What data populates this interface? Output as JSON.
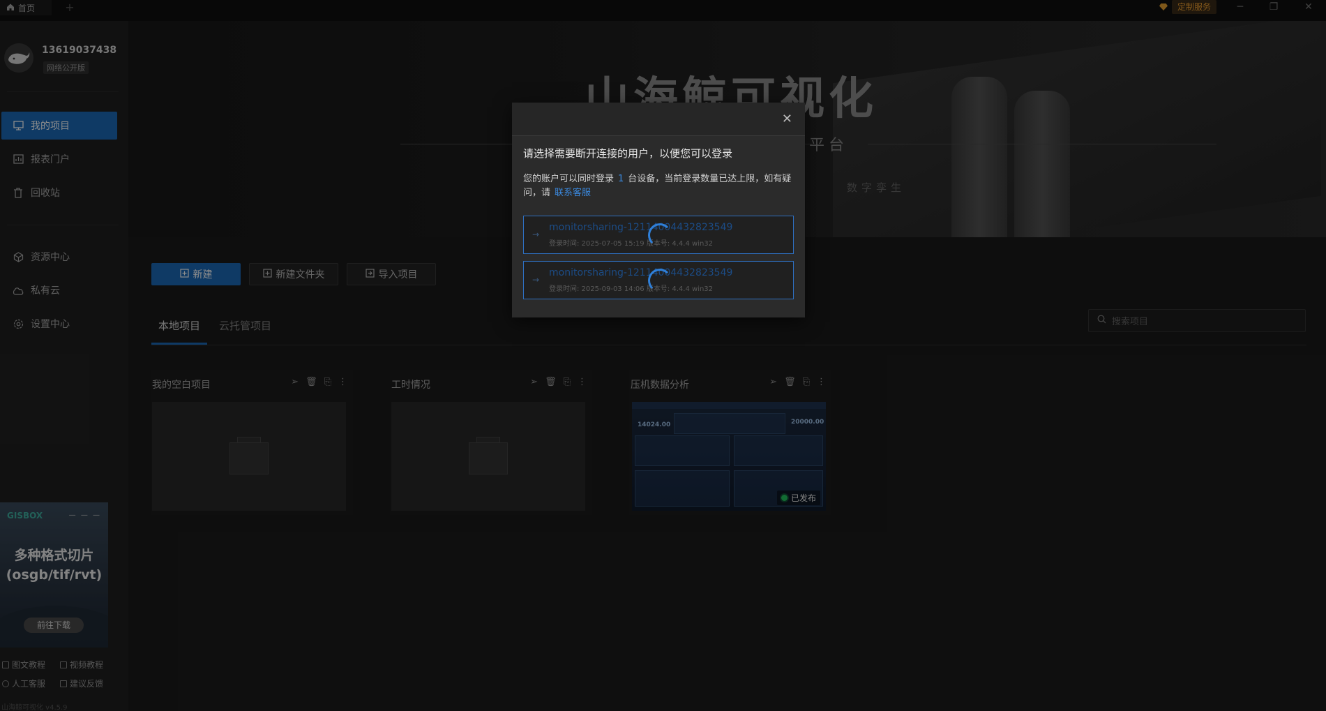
{
  "titlebar": {
    "home_tab": "首页",
    "add_tab": "+",
    "custom_service": "定制服务",
    "minimize": "─",
    "maximize": "❐",
    "close": "✕"
  },
  "user": {
    "name": "13619037438",
    "badge": "网络公开版"
  },
  "nav": [
    {
      "label": "我的项目",
      "icon": "monitor-icon",
      "active": true
    },
    {
      "label": "报表门户",
      "icon": "chart-icon",
      "active": false
    },
    {
      "label": "回收站",
      "icon": "trash-icon",
      "active": false
    },
    {
      "label": "资源中心",
      "icon": "cube-icon",
      "active": false
    },
    {
      "label": "私有云",
      "icon": "cloud-icon",
      "active": false
    },
    {
      "label": "设置中心",
      "icon": "gear-icon",
      "active": false
    }
  ],
  "promo": {
    "brand": "GISBOX",
    "title_line1": "多种格式切片",
    "title_line2": "(osgb/tif/rvt)",
    "button": "前往下载"
  },
  "help_links": {
    "graphic_tutorial": "图文教程",
    "video_tutorial": "视频教程",
    "support": "人工客服",
    "feedback": "建议反馈"
  },
  "version": "山海鲸可视化 v4.5.9",
  "banner": {
    "title": "山海鲸可视化",
    "subtitle": "平台",
    "tagline": "数字孪生"
  },
  "toolbar": {
    "new": "新建",
    "new_folder": "新建文件夹",
    "import": "导入项目"
  },
  "tabs": {
    "local": "本地项目",
    "cloud": "云托管项目"
  },
  "search": {
    "placeholder": "搜索项目"
  },
  "projects": [
    {
      "name": "我的空白项目",
      "type": "blank"
    },
    {
      "name": "工时情况",
      "type": "blank"
    },
    {
      "name": "压机数据分析",
      "type": "dashboard",
      "status": "已发布",
      "kpi1": "14024.00",
      "kpi2": "20000.00"
    }
  ],
  "modal": {
    "title": "请选择需要断开连接的用户，以便您可以登录",
    "desc_prefix": "您的账户可以同时登录",
    "device_count": "1",
    "desc_suffix": "台设备，当前登录数量已达上限，如有疑问，请",
    "contact_link": "联系客服",
    "sessions": [
      {
        "name": "monitorsharing-12114004432823549",
        "meta": "登录时间: 2025-07-05 15:19  版本号: 4.4.4 win32"
      },
      {
        "name": "monitorsharing-12114004432823549",
        "meta": "登录时间: 2025-09-03 14:06  版本号: 4.4.4 win32"
      }
    ]
  },
  "colors": {
    "accent": "#1d6ab8",
    "link": "#3b8ae0",
    "published": "#22c55e",
    "custom_service": "#f0a030"
  }
}
